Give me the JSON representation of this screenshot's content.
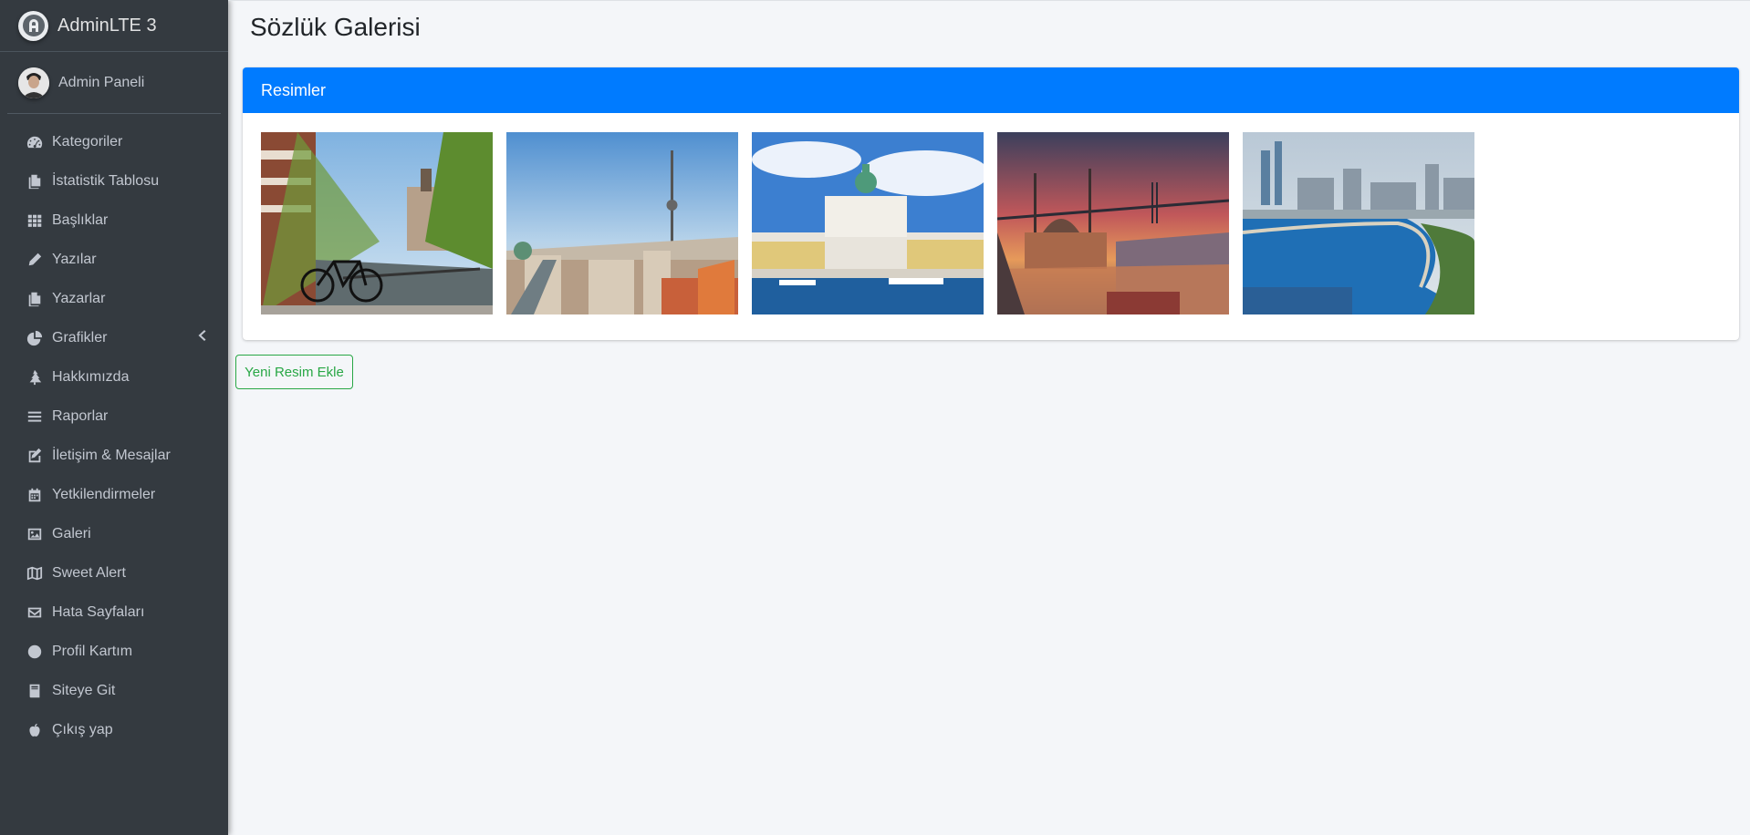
{
  "brand": {
    "name": "AdminLTE 3",
    "logo_icon": "adminlte-logo-icon"
  },
  "user": {
    "name": "Admin Paneli",
    "avatar_icon": "user-avatar"
  },
  "sidebar": {
    "items": [
      {
        "label": "Kategoriler",
        "icon": "tachometer-icon"
      },
      {
        "label": "İstatistik Tablosu",
        "icon": "copy-icon"
      },
      {
        "label": "Başlıklar",
        "icon": "th-icon"
      },
      {
        "label": "Yazılar",
        "icon": "pencil-icon"
      },
      {
        "label": "Yazarlar",
        "icon": "copy-icon"
      },
      {
        "label": "Grafikler",
        "icon": "pie-chart-icon",
        "has_submenu": true
      },
      {
        "label": "Hakkımızda",
        "icon": "tree-icon"
      },
      {
        "label": "Raporlar",
        "icon": "bars-icon"
      },
      {
        "label": "İletişim & Mesajlar",
        "icon": "edit-icon"
      },
      {
        "label": "Yetkilendirmeler",
        "icon": "calendar-icon"
      },
      {
        "label": "Galeri",
        "icon": "image-icon"
      },
      {
        "label": "Sweet Alert",
        "icon": "map-icon"
      },
      {
        "label": "Hata Sayfaları",
        "icon": "envelope-icon"
      },
      {
        "label": "Profil Kartım",
        "icon": "circle-icon"
      },
      {
        "label": "Siteye Git",
        "icon": "book-icon"
      },
      {
        "label": "Çıkış yap",
        "icon": "apple-icon"
      }
    ]
  },
  "main": {
    "title": "Sözlük Galerisi",
    "card_title": "Resimler",
    "add_button": "Yeni Resim Ekle",
    "images": [
      {
        "subject": "Amsterdam canal with bicycle"
      },
      {
        "subject": "Berlin skyline with TV tower"
      },
      {
        "subject": "Helsinki cathedral and harbor"
      },
      {
        "subject": "Istanbul Ortaköy mosque and bridge at sunset"
      },
      {
        "subject": "Baku bay and skyline"
      }
    ]
  },
  "colors": {
    "sidebar_bg": "#343a40",
    "sidebar_text": "#c2c7d0",
    "primary": "#007bff",
    "success": "#28a745",
    "content_bg": "#f4f6f9"
  }
}
